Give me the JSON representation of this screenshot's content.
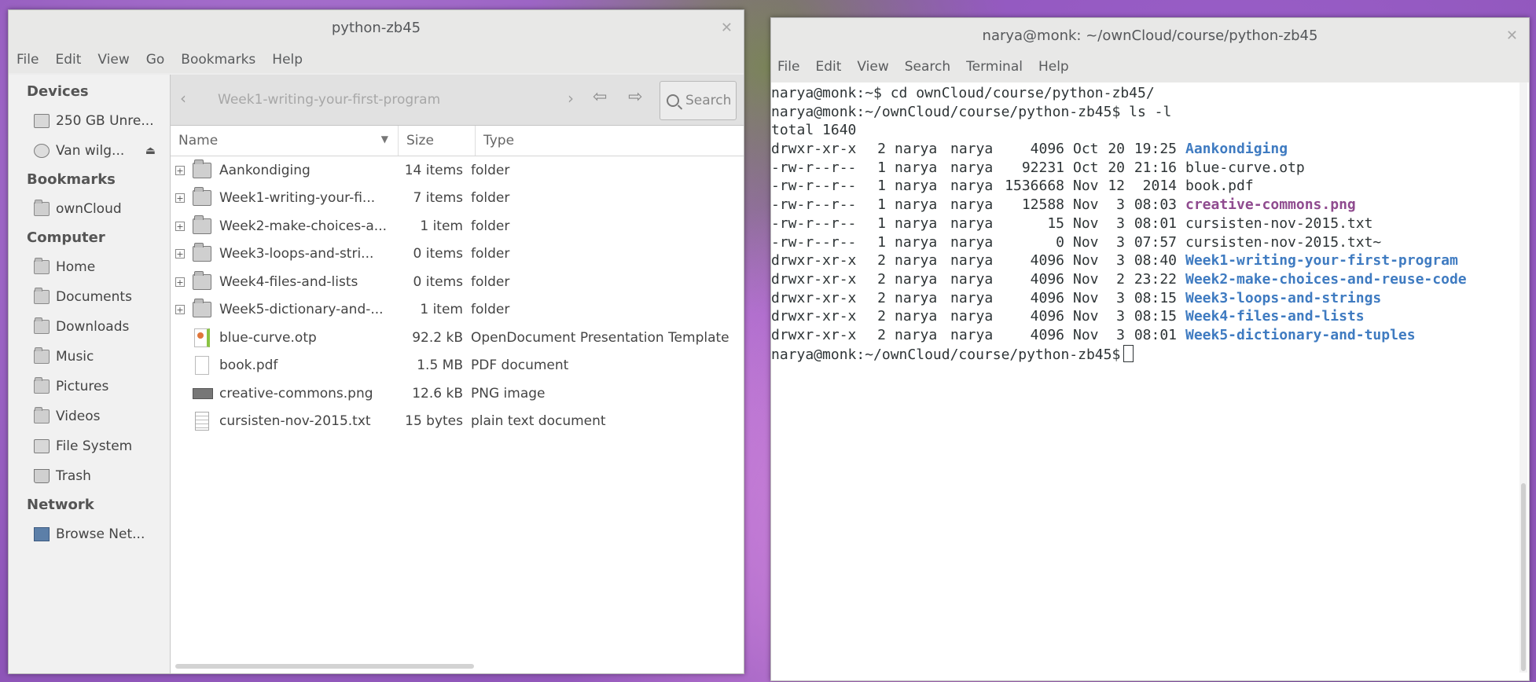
{
  "file_manager": {
    "title": "python-zb45",
    "menu": [
      "File",
      "Edit",
      "View",
      "Go",
      "Bookmarks",
      "Help"
    ],
    "sidebar": {
      "devices_header": "Devices",
      "devices": [
        "250 GB Unre...",
        "Van wilg..."
      ],
      "bookmarks_header": "Bookmarks",
      "bookmarks": [
        "ownCloud"
      ],
      "computer_header": "Computer",
      "computer": [
        "Home",
        "Documents",
        "Downloads",
        "Music",
        "Pictures",
        "Videos",
        "File System",
        "Trash"
      ],
      "network_header": "Network",
      "network": [
        "Browse Net..."
      ]
    },
    "pathbar": {
      "crumb": "Week1-writing-your-first-program",
      "search_label": "Search"
    },
    "columns": {
      "name": "Name",
      "size": "Size",
      "type": "Type"
    },
    "rows": [
      {
        "name": "Aankondiging",
        "size": "14 items",
        "type": "folder"
      },
      {
        "name": "Week1-writing-your-fi...",
        "size": "7 items",
        "type": "folder"
      },
      {
        "name": "Week2-make-choices-a...",
        "size": "1 item",
        "type": "folder"
      },
      {
        "name": "Week3-loops-and-stri...",
        "size": "0 items",
        "type": "folder"
      },
      {
        "name": "Week4-files-and-lists",
        "size": "0 items",
        "type": "folder"
      },
      {
        "name": "Week5-dictionary-and-...",
        "size": "1 item",
        "type": "folder"
      },
      {
        "name": "blue-curve.otp",
        "size": "92.2 kB",
        "type": "OpenDocument Presentation Template"
      },
      {
        "name": "book.pdf",
        "size": "1.5 MB",
        "type": "PDF document"
      },
      {
        "name": "creative-commons.png",
        "size": "12.6 kB",
        "type": "PNG image"
      },
      {
        "name": "cursisten-nov-2015.txt",
        "size": "15 bytes",
        "type": "plain text document"
      }
    ]
  },
  "terminal": {
    "title": "narya@monk: ~/ownCloud/course/python-zb45",
    "menu": [
      "File",
      "Edit",
      "View",
      "Search",
      "Terminal",
      "Help"
    ],
    "cmd1": "narya@monk:~$ cd ownCloud/course/python-zb45/",
    "cmd2": "narya@monk:~/ownCloud/course/python-zb45$ ls -l",
    "total": "total 1640",
    "listing": [
      {
        "perm": "drwxr-xr-x",
        "links": "2",
        "owner": "narya",
        "group": "narya",
        "size": "4096",
        "mon": "Oct",
        "day": "20",
        "time": "19:25",
        "name": "Aankondiging"
      },
      {
        "perm": "-rw-r--r--",
        "links": "1",
        "owner": "narya",
        "group": "narya",
        "size": "92231",
        "mon": "Oct",
        "day": "20",
        "time": "21:16",
        "name": "blue-curve.otp"
      },
      {
        "perm": "-rw-r--r--",
        "links": "1",
        "owner": "narya",
        "group": "narya",
        "size": "1536668",
        "mon": "Nov",
        "day": "12",
        "time": "2014",
        "name": "book.pdf"
      },
      {
        "perm": "-rw-r--r--",
        "links": "1",
        "owner": "narya",
        "group": "narya",
        "size": "12588",
        "mon": "Nov",
        "day": "3",
        "time": "08:03",
        "name": "creative-commons.png"
      },
      {
        "perm": "-rw-r--r--",
        "links": "1",
        "owner": "narya",
        "group": "narya",
        "size": "15",
        "mon": "Nov",
        "day": "3",
        "time": "08:01",
        "name": "cursisten-nov-2015.txt"
      },
      {
        "perm": "-rw-r--r--",
        "links": "1",
        "owner": "narya",
        "group": "narya",
        "size": "0",
        "mon": "Nov",
        "day": "3",
        "time": "07:57",
        "name": "cursisten-nov-2015.txt~"
      },
      {
        "perm": "drwxr-xr-x",
        "links": "2",
        "owner": "narya",
        "group": "narya",
        "size": "4096",
        "mon": "Nov",
        "day": "3",
        "time": "08:40",
        "name": "Week1-writing-your-first-program"
      },
      {
        "perm": "drwxr-xr-x",
        "links": "2",
        "owner": "narya",
        "group": "narya",
        "size": "4096",
        "mon": "Nov",
        "day": "2",
        "time": "23:22",
        "name": "Week2-make-choices-and-reuse-code"
      },
      {
        "perm": "drwxr-xr-x",
        "links": "2",
        "owner": "narya",
        "group": "narya",
        "size": "4096",
        "mon": "Nov",
        "day": "3",
        "time": "08:15",
        "name": "Week3-loops-and-strings"
      },
      {
        "perm": "drwxr-xr-x",
        "links": "2",
        "owner": "narya",
        "group": "narya",
        "size": "4096",
        "mon": "Nov",
        "day": "3",
        "time": "08:15",
        "name": "Week4-files-and-lists"
      },
      {
        "perm": "drwxr-xr-x",
        "links": "2",
        "owner": "narya",
        "group": "narya",
        "size": "4096",
        "mon": "Nov",
        "day": "3",
        "time": "08:01",
        "name": "Week5-dictionary-and-tuples"
      }
    ],
    "prompt": "narya@monk:~/ownCloud/course/python-zb45$",
    "colors": {
      "directory": "#3f7bc1",
      "image": "#8f4b8f",
      "text": "#2e3436"
    }
  }
}
